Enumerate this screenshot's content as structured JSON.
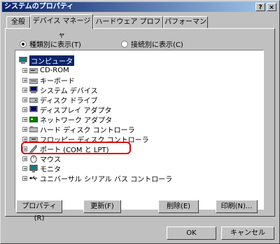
{
  "window": {
    "title": "システムのプロパティ"
  },
  "title_buttons": {
    "help": "?",
    "close": "×"
  },
  "tabs": [
    "全般",
    "デバイス マネージャ",
    "ハードウェア プロファイル",
    "パフォーマンス"
  ],
  "view_options": {
    "by_type": "種類別に表示(T)",
    "by_connection": "接続別に表示(C)"
  },
  "tree": {
    "root": "コンピュータ",
    "items": [
      {
        "label": "CD-ROM",
        "icon": "cdrom-icon"
      },
      {
        "label": "キーボード",
        "icon": "keyboard-icon"
      },
      {
        "label": "システム デバイス",
        "icon": "system-device-icon"
      },
      {
        "label": "ディスク ドライブ",
        "icon": "disk-drive-icon"
      },
      {
        "label": "ディスプレイ アダプタ",
        "icon": "display-adapter-icon"
      },
      {
        "label": "ネットワーク アダプタ",
        "icon": "network-adapter-icon"
      },
      {
        "label": "ハード ディスク コントローラ",
        "icon": "hdd-controller-icon"
      },
      {
        "label": "フロッピー ディスク コントローラ",
        "icon": "floppy-controller-icon"
      },
      {
        "label": "ポート (COM と LPT)",
        "icon": "port-icon"
      },
      {
        "label": "マウス",
        "icon": "mouse-icon"
      },
      {
        "label": "モニタ",
        "icon": "monitor-icon"
      },
      {
        "label": "ユニバーサル シリアル バス コントローラ",
        "icon": "usb-icon"
      }
    ]
  },
  "buttons": {
    "properties": "プロパティ(R)",
    "refresh": "更新(F)",
    "remove": "削除(E)",
    "print": "印刷(N)..."
  },
  "footer": {
    "ok": "OK",
    "cancel": "キャンセル"
  }
}
